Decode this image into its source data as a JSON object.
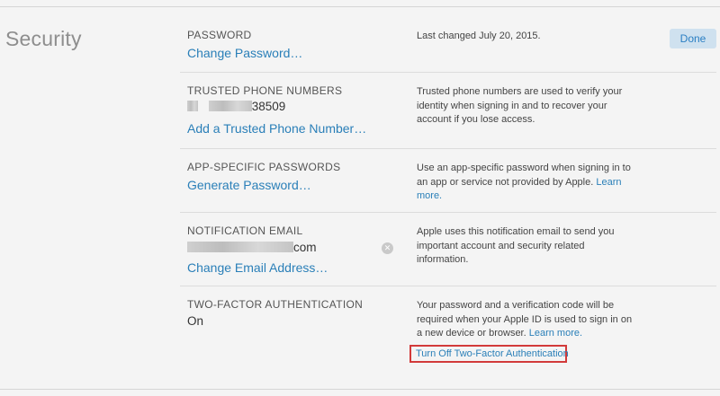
{
  "section": {
    "title": "Security"
  },
  "actions": {
    "done_label": "Done"
  },
  "rows": {
    "password": {
      "label": "PASSWORD",
      "link": "Change Password…",
      "description": "Last changed July 20, 2015."
    },
    "trusted_phones": {
      "label": "TRUSTED PHONE NUMBERS",
      "phone_suffix": "38509",
      "link": "Add a Trusted Phone Number…",
      "description": "Trusted phone numbers are used to verify your identity when signing in and to recover your account if you lose access."
    },
    "app_passwords": {
      "label": "APP-SPECIFIC PASSWORDS",
      "link": "Generate Password…",
      "description": "Use an app-specific password when signing in to an app or service not provided by Apple.",
      "learn_more": "Learn more."
    },
    "notification_email": {
      "label": "NOTIFICATION EMAIL",
      "email_suffix": "com",
      "clear_icon": "clear-x-icon",
      "link": "Change Email Address…",
      "description": "Apple uses this notification email to send you important account and security related information."
    },
    "two_factor": {
      "label": "TWO-FACTOR AUTHENTICATION",
      "status": "On",
      "description": "Your password and a verification code will be required when your Apple ID is used to sign in on a new device or browser.",
      "learn_more": "Learn more.",
      "turn_off_link": "Turn Off Two-Factor Authentication"
    }
  },
  "colors": {
    "link": "#2a7fb8",
    "highlight_border": "#d23a3a",
    "done_bg": "#cfe1ef"
  }
}
